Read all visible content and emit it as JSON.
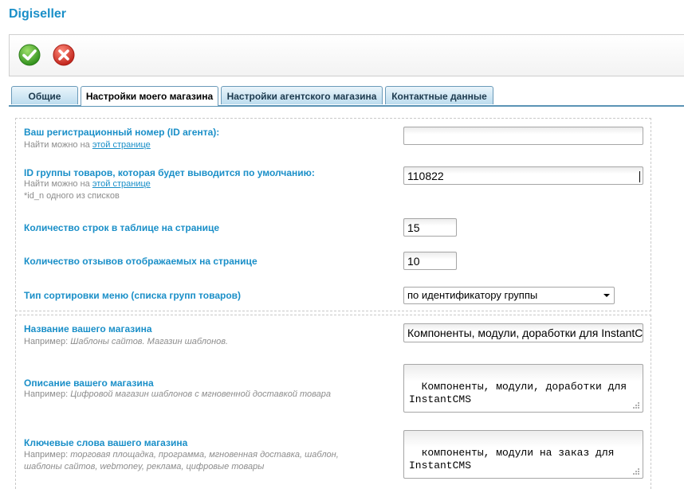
{
  "app": {
    "title": "Digiseller"
  },
  "toolbar": {
    "save": "save-icon",
    "cancel": "cancel-icon"
  },
  "tabs": [
    {
      "label": "Общие"
    },
    {
      "label": "Настройки моего магазина",
      "active": true
    },
    {
      "label": "Настройки агентского магазина"
    },
    {
      "label": "Контактные данные"
    }
  ],
  "form": {
    "agent_id": {
      "label": "Ваш регистрационный номер (ID агента):",
      "hint_prefix": "Найти можно на",
      "hint_link": "этой странице",
      "value": ""
    },
    "group_id": {
      "label": "ID группы товаров, которая будет выводится по умолчанию:",
      "hint_prefix": "Найти можно на",
      "hint_link": "этой странице",
      "hint_extra": "*id_n одного из списков",
      "value": "110822"
    },
    "rows_per_page": {
      "label": "Количество строк в таблице на странице",
      "value": "15"
    },
    "reviews_per_page": {
      "label": "Количество отзывов отображаемых на странице",
      "value": "10"
    },
    "menu_sort": {
      "label": "Тип сортировки меню (списка групп товаров)",
      "value": "по идентификатору группы"
    },
    "shop_name": {
      "label": "Название вашего магазина",
      "hint_prefix": "Например:",
      "hint_example": "Шаблоны сайтов. Магазин шаблонов.",
      "value": "Компоненты, модули, доработки для InstantCMS"
    },
    "shop_description": {
      "label": "Описание вашего магазина",
      "hint_prefix": "Например:",
      "hint_example": "Цифровой магазин шаблонов с мгновенной доставкой товара",
      "value": "Компоненты, модули, доработки для\nInstantCMS"
    },
    "shop_keywords": {
      "label": "Ключевые слова вашего магазина",
      "hint_prefix": "Например:",
      "hint_example_line1": "торговая площадка, программа, мгновенная доставка, шаблон,",
      "hint_example_line2": "шаблоны сайтов, webmoney, реклама, цифровые товары",
      "value": "компоненты, модули на заказ для\nInstantCMS"
    }
  },
  "colors": {
    "accent": "#1a8fc8",
    "hint": "#8c8c8c",
    "tab_border": "#6a9ab9"
  }
}
